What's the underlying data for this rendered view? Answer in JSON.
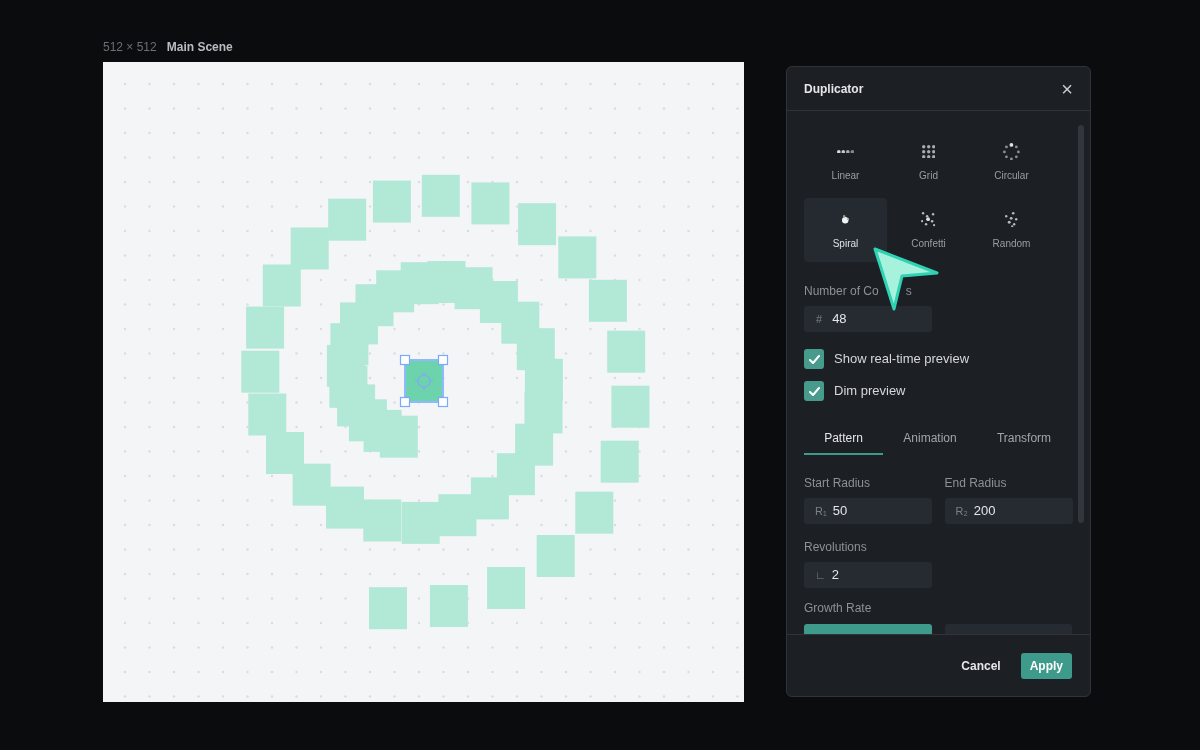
{
  "canvas": {
    "size": "512 × 512",
    "title": "Main Scene"
  },
  "panel": {
    "title": "Duplicator",
    "close": "×"
  },
  "patterns": [
    {
      "kind": "linear",
      "label": "Linear",
      "selected": false
    },
    {
      "kind": "grid",
      "label": "Grid",
      "selected": false
    },
    {
      "kind": "circular",
      "label": "Circular",
      "selected": false
    },
    {
      "kind": "spiral",
      "label": "Spiral",
      "selected": true
    },
    {
      "kind": "confetti",
      "label": "Confetti",
      "selected": false
    },
    {
      "kind": "random",
      "label": "Random",
      "selected": false
    }
  ],
  "copies": {
    "label": "Number of Co",
    "label_tail": "s",
    "prefix": "#",
    "value": "48"
  },
  "options": [
    {
      "label": "Show real-time preview",
      "checked": true
    },
    {
      "label": "Dim preview",
      "checked": true
    }
  ],
  "tabs": [
    {
      "label": "Pattern",
      "selected": true
    },
    {
      "label": "Animation",
      "selected": false
    },
    {
      "label": "Transform",
      "selected": false
    }
  ],
  "fields": [
    {
      "label": "Start Radius",
      "prefix": "R₁",
      "value": "50"
    },
    {
      "label": "End Radius",
      "prefix": "R₂",
      "value": "200"
    },
    {
      "label": "Revolutions",
      "prefix": "∟",
      "value": "2"
    }
  ],
  "growth": {
    "label": "Growth Rate"
  },
  "buttons": {
    "cancel": "Cancel",
    "apply": "Apply"
  }
}
